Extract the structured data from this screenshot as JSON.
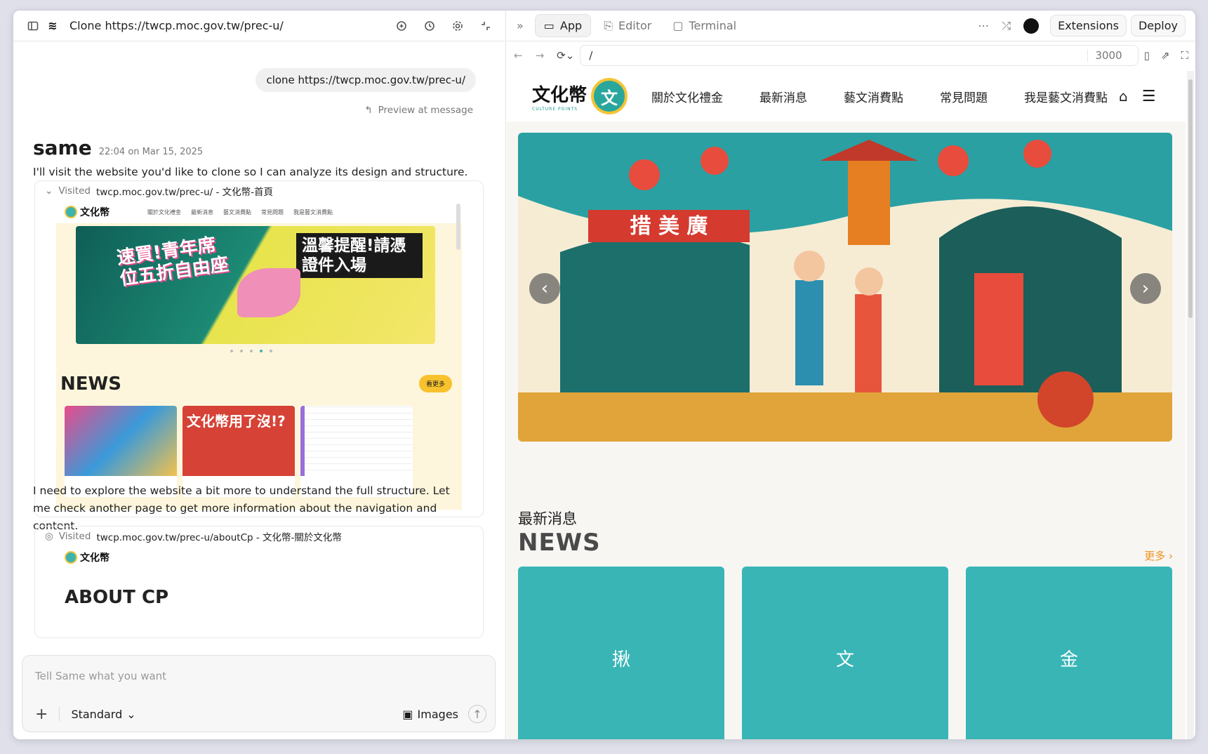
{
  "left": {
    "title": "Clone https://twcp.moc.gov.tw/prec-u/",
    "user_message": "clone https://twcp.moc.gov.tw/prec-u/",
    "preview_label": "Preview at message",
    "assistant_name": "same",
    "timestamp": "22:04 on Mar 15, 2025",
    "msg1": "I'll visit the website you'd like to clone so I can analyze its design and structure.",
    "visit1": {
      "label": "Visited",
      "url": "twcp.moc.gov.tw/prec-u/ - 文化幣-首頁"
    },
    "visit1_shot": {
      "logo": "文化幣",
      "nav": [
        "關於文化禮金",
        "最新消息",
        "藝文消費點",
        "常見問題",
        "我是藝文消費點"
      ],
      "banner_text_1": "速買!青年席位五折自由座",
      "banner_text_2": "溫馨提醒!請憑證件入場",
      "news_heading": "NEWS",
      "more": "看更多",
      "thumb_title": "文化幣用了沒!?"
    },
    "msg2": "I need to explore the website a bit more to understand the full structure. Let me check another page to get more information about the navigation and content.",
    "visit2": {
      "label": "Visited",
      "url": "twcp.moc.gov.tw/prec-u/aboutCp - 文化幣-關於文化幣"
    },
    "visit2_shot": {
      "logo": "文化幣",
      "heading": "ABOUT CP"
    },
    "input_placeholder": "Tell Same what you want",
    "mode": "Standard",
    "images_label": "Images"
  },
  "right": {
    "tabs": [
      {
        "label": "App"
      },
      {
        "label": "Editor"
      },
      {
        "label": "Terminal"
      }
    ],
    "extensions": "Extensions",
    "deploy": "Deploy",
    "path": "/",
    "port": "3000",
    "site": {
      "logo_text": "文化幣",
      "logo_sub": "CULTURE POINTS",
      "nav": [
        "關於文化禮金",
        "最新消息",
        "藝文消費點",
        "常見問題",
        "我是藝文消費點"
      ],
      "hero_sign": "措 美 廣",
      "news_zh": "最新消息",
      "news_en": "NEWS",
      "more": "更多 ›",
      "cards": [
        "揪",
        "文",
        "金"
      ]
    }
  }
}
